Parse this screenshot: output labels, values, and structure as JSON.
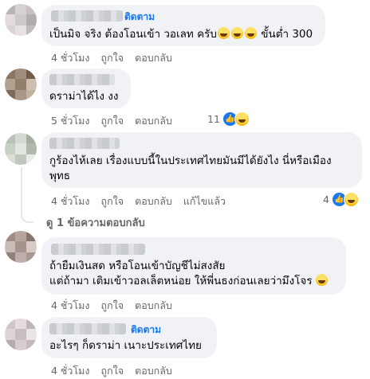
{
  "comments": [
    {
      "follow": "ติดตาม",
      "text": "เป็นมิจ จริง ต้องโอนเข้า วอเลท ครับ",
      "text_tail": " ขั้นต่ำ 300",
      "time": "4 ชั่วโมง",
      "like": "ถูกใจ",
      "reply": "ตอบกลับ"
    },
    {
      "text": "ดราม่าได้ไง งง",
      "time": "5 ชั่วโมง",
      "like": "ถูกใจ",
      "reply": "ตอบกลับ",
      "reaction_count": "11"
    },
    {
      "text_line1": "กูร้องไห้เลย เรื่องแบบนี้ในประเทศไทยมันมีได้ยังไง นี่หรือเมือง",
      "text_line2": "พุทธ",
      "time": "4 ชั่วโมง",
      "like": "ถูกใจ",
      "reply": "ตอบกลับ",
      "edited": "แก้ไขแล้ว",
      "reaction_count": "4",
      "view_replies": "ดู 1 ข้อความตอบกลับ"
    },
    {
      "text_line1": "ถ้ายืมเงินสด หรือโอนเข้าบัญชีไม่สงสัย",
      "text_line2": "แต่ถ้ามา เติมเข้าวอลเล็ตหน่อย ให้พี่นธงก่อนเลยว่ามึงโจร",
      "time": "4 ชั่วโมง",
      "like": "ถูกใจ",
      "reply": "ตอบกลับ"
    },
    {
      "follow": "ติดตาม",
      "text": "อะไรๆ ก็ดราม่า เนาะประเทศไทย",
      "time": "4 ชั่วโมง",
      "like": "ถูกใจ",
      "reply": "ตอบกลับ"
    }
  ],
  "colors": {
    "bubble": "#f0f2f5",
    "link": "#1877f2",
    "meta": "#65676b"
  },
  "icons": [
    "avatar-pixelated",
    "haha-emoji",
    "like-reaction-icon",
    "haha-reaction-icon"
  ]
}
